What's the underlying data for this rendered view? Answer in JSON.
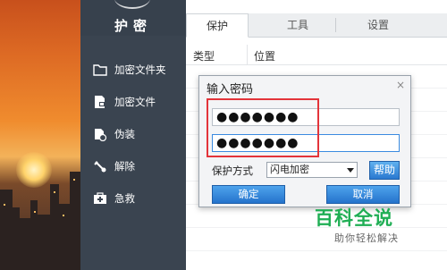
{
  "header": {
    "title": "护密"
  },
  "sidebar": {
    "items": [
      {
        "label": "加密文件夹",
        "icon": "folder-icon"
      },
      {
        "label": "加密文件",
        "icon": "file-lock-icon"
      },
      {
        "label": "伪装",
        "icon": "disguise-icon"
      },
      {
        "label": "解除",
        "icon": "unlock-icon"
      },
      {
        "label": "急救",
        "icon": "first-aid-icon"
      }
    ]
  },
  "tabs": [
    {
      "label": "保护",
      "active": true
    },
    {
      "label": "工具",
      "active": false
    },
    {
      "label": "设置",
      "active": false
    }
  ],
  "table": {
    "columns": [
      "类型",
      "位置"
    ]
  },
  "dialog": {
    "title": "输入密码",
    "close": "×",
    "password1": "●●●●●●●",
    "password2": "●●●●●●●",
    "mode_label": "保护方式",
    "mode_value": "闪电加密",
    "help_label": "帮助",
    "ok_label": "确定",
    "cancel_label": "取消"
  },
  "watermark": {
    "title": "百科全说",
    "subtitle": "助你轻松解决"
  },
  "colors": {
    "sidebar": "#3a4450",
    "accent": "#2a79d0",
    "highlight": "#e3343a",
    "watermark": "#1fae54"
  }
}
